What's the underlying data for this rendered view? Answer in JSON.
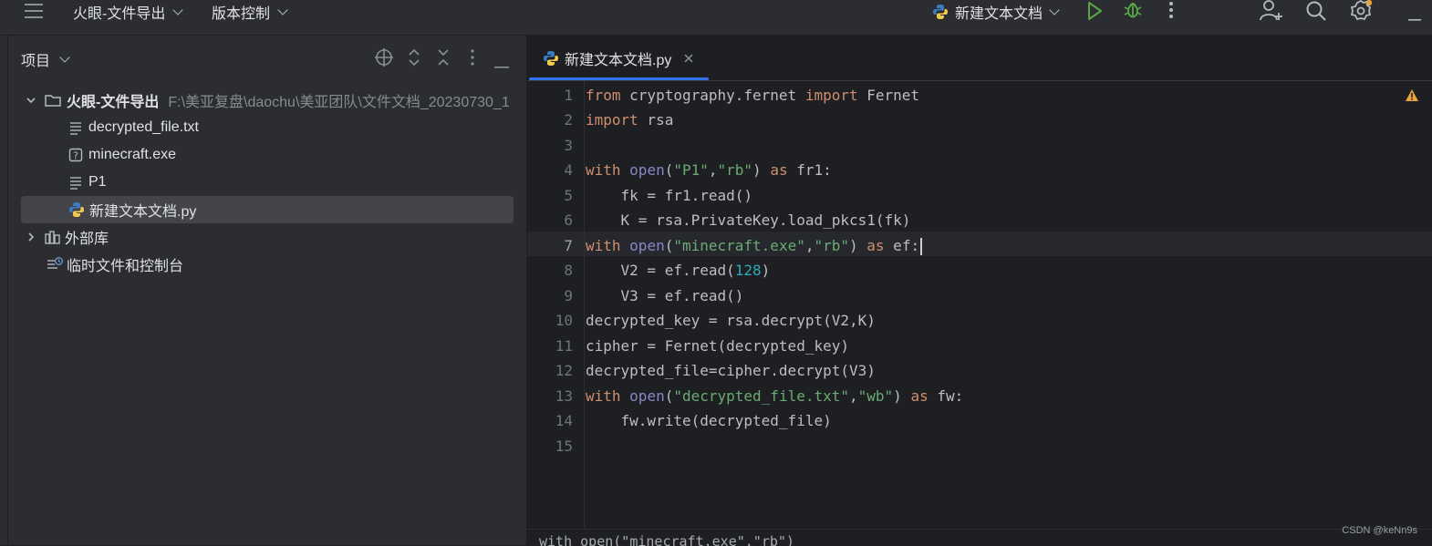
{
  "toolbar": {
    "project_name": "火眼-文件导出",
    "vcs_label": "版本控制",
    "run_config": "新建文本文档"
  },
  "project_panel": {
    "title": "项目",
    "root": {
      "name": "火眼-文件导出",
      "path": "F:\\美亚复盘\\daochu\\美亚团队\\文件文档_20230730_1"
    },
    "files": [
      {
        "name": "decrypted_file.txt",
        "icon": "text-file-icon"
      },
      {
        "name": "minecraft.exe",
        "icon": "unknown-file-icon"
      },
      {
        "name": "P1",
        "icon": "text-file-icon"
      },
      {
        "name": "新建文本文档.py",
        "icon": "python-file-icon",
        "selected": true
      }
    ],
    "external_libs": "外部库",
    "scratches": "临时文件和控制台"
  },
  "editor": {
    "tab_label": "新建文本文档.py",
    "active_line": 7,
    "line_numbers": [
      "1",
      "2",
      "3",
      "4",
      "5",
      "6",
      "7",
      "8",
      "9",
      "10",
      "11",
      "12",
      "13",
      "14",
      "15"
    ],
    "breadcrumb": "with open(\"minecraft.exe\",\"rb\")"
  },
  "watermark": "CSDN @keNn9s",
  "colors": {
    "accent": "#3574f0",
    "keyword": "#cf8e6d",
    "string": "#6aab73",
    "number": "#2aacb8",
    "builtin": "#8888c6"
  }
}
